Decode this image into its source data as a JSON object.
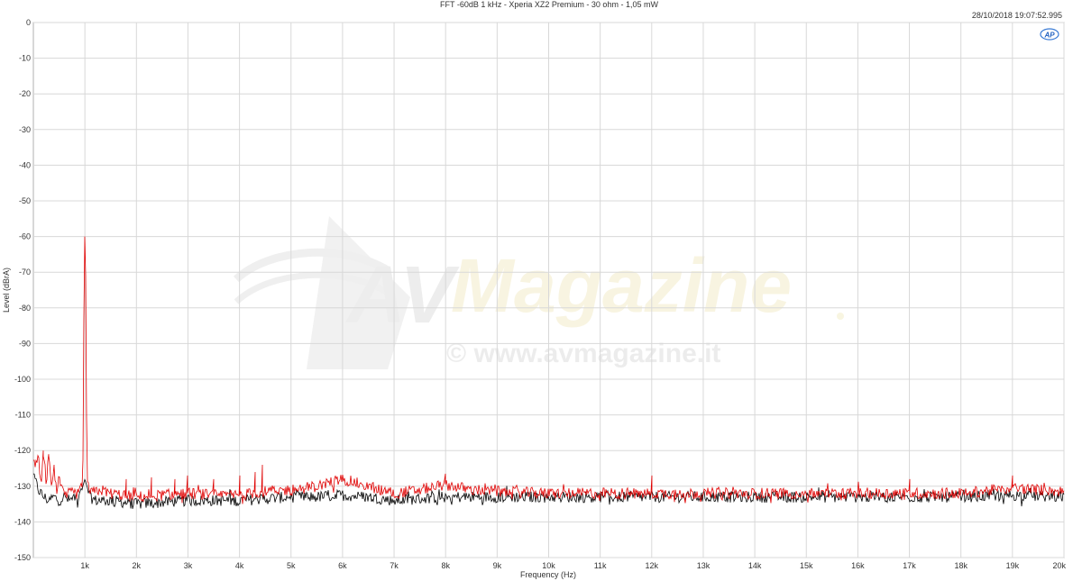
{
  "chart_data": {
    "type": "line",
    "title": "FFT -60dB 1 kHz - Xperia XZ2 Premium - 30 ohm - 1,05 mW",
    "timestamp": "28/10/2018 19:07:52.995",
    "xlabel": "Frequency (Hz)",
    "ylabel": "Level (dBrA)",
    "xlim": [
      0,
      20000
    ],
    "ylim": [
      -150,
      0
    ],
    "grid": true,
    "x_ticks": [
      {
        "value": 1000,
        "label": "1k"
      },
      {
        "value": 2000,
        "label": "2k"
      },
      {
        "value": 3000,
        "label": "3k"
      },
      {
        "value": 4000,
        "label": "4k"
      },
      {
        "value": 5000,
        "label": "5k"
      },
      {
        "value": 6000,
        "label": "6k"
      },
      {
        "value": 7000,
        "label": "7k"
      },
      {
        "value": 8000,
        "label": "8k"
      },
      {
        "value": 9000,
        "label": "9k"
      },
      {
        "value": 10000,
        "label": "10k"
      },
      {
        "value": 11000,
        "label": "11k"
      },
      {
        "value": 12000,
        "label": "12k"
      },
      {
        "value": 13000,
        "label": "13k"
      },
      {
        "value": 14000,
        "label": "14k"
      },
      {
        "value": 15000,
        "label": "15k"
      },
      {
        "value": 16000,
        "label": "16k"
      },
      {
        "value": 17000,
        "label": "17k"
      },
      {
        "value": 18000,
        "label": "18k"
      },
      {
        "value": 19000,
        "label": "19k"
      },
      {
        "value": 20000,
        "label": "20k"
      }
    ],
    "y_ticks": [
      {
        "value": 0,
        "label": "0"
      },
      {
        "value": -10,
        "label": "-10"
      },
      {
        "value": -20,
        "label": "-20"
      },
      {
        "value": -30,
        "label": "-30"
      },
      {
        "value": -40,
        "label": "-40"
      },
      {
        "value": -50,
        "label": "-50"
      },
      {
        "value": -60,
        "label": "-60"
      },
      {
        "value": -70,
        "label": "-70"
      },
      {
        "value": -80,
        "label": "-80"
      },
      {
        "value": -90,
        "label": "-90"
      },
      {
        "value": -100,
        "label": "-100"
      },
      {
        "value": -110,
        "label": "-110"
      },
      {
        "value": -120,
        "label": "-120"
      },
      {
        "value": -130,
        "label": "-130"
      },
      {
        "value": -140,
        "label": "-140"
      },
      {
        "value": -150,
        "label": "-150"
      }
    ],
    "series": [
      {
        "color": "#000000",
        "points": [
          [
            0,
            -127
          ],
          [
            100,
            -131
          ],
          [
            200,
            -133
          ],
          [
            300,
            -134
          ],
          [
            400,
            -133
          ],
          [
            500,
            -134
          ],
          [
            600,
            -133
          ],
          [
            700,
            -134
          ],
          [
            800,
            -133
          ],
          [
            900,
            -133
          ],
          [
            960,
            -130
          ],
          [
            1000,
            -128
          ],
          [
            1040,
            -130
          ],
          [
            1100,
            -133
          ],
          [
            1200,
            -134
          ],
          [
            1500,
            -134
          ],
          [
            2000,
            -135
          ],
          [
            2500,
            -134.5
          ],
          [
            3000,
            -134
          ],
          [
            3500,
            -134
          ],
          [
            4000,
            -134
          ],
          [
            4500,
            -133.5
          ],
          [
            5000,
            -133
          ],
          [
            5500,
            -133
          ],
          [
            6000,
            -132.5
          ],
          [
            6500,
            -133
          ],
          [
            7000,
            -134
          ],
          [
            7500,
            -133.5
          ],
          [
            8000,
            -133
          ],
          [
            8500,
            -133
          ],
          [
            9000,
            -133
          ],
          [
            10000,
            -133
          ],
          [
            11000,
            -133
          ],
          [
            12000,
            -133
          ],
          [
            13000,
            -133
          ],
          [
            14000,
            -133
          ],
          [
            15000,
            -133
          ],
          [
            16000,
            -133
          ],
          [
            17000,
            -133
          ],
          [
            18000,
            -133
          ],
          [
            19000,
            -132.5
          ],
          [
            20000,
            -133
          ]
        ]
      },
      {
        "color": "#e00000",
        "points": [
          [
            0,
            -124
          ],
          [
            100,
            -122
          ],
          [
            150,
            -131
          ],
          [
            200,
            -120
          ],
          [
            250,
            -130
          ],
          [
            300,
            -121
          ],
          [
            350,
            -131
          ],
          [
            400,
            -124
          ],
          [
            450,
            -132
          ],
          [
            500,
            -128
          ],
          [
            550,
            -131
          ],
          [
            600,
            -133
          ],
          [
            700,
            -132
          ],
          [
            800,
            -132
          ],
          [
            900,
            -132
          ],
          [
            960,
            -128
          ],
          [
            990,
            -60
          ],
          [
            1010,
            -60
          ],
          [
            1040,
            -128
          ],
          [
            1100,
            -132
          ],
          [
            1300,
            -131
          ],
          [
            1500,
            -132
          ],
          [
            2000,
            -133
          ],
          [
            2500,
            -132.5
          ],
          [
            3000,
            -132
          ],
          [
            3500,
            -132.5
          ],
          [
            4000,
            -132.5
          ],
          [
            4500,
            -131.5
          ],
          [
            5000,
            -131
          ],
          [
            5500,
            -130
          ],
          [
            6000,
            -128
          ],
          [
            6500,
            -130
          ],
          [
            7000,
            -132
          ],
          [
            7500,
            -131
          ],
          [
            8000,
            -129.5
          ],
          [
            8500,
            -131
          ],
          [
            9000,
            -131.5
          ],
          [
            10000,
            -132
          ],
          [
            11000,
            -132
          ],
          [
            12000,
            -132
          ],
          [
            13000,
            -132
          ],
          [
            14000,
            -132
          ],
          [
            15000,
            -132
          ],
          [
            16000,
            -132
          ],
          [
            17000,
            -132
          ],
          [
            18000,
            -132
          ],
          [
            19000,
            -130.5
          ],
          [
            20000,
            -131.5
          ]
        ],
        "spikes": [
          [
            200,
            -120
          ],
          [
            300,
            -121
          ],
          [
            400,
            -124
          ],
          [
            1800,
            -128
          ],
          [
            2300,
            -127.5
          ],
          [
            2750,
            -128
          ],
          [
            3000,
            -127
          ],
          [
            3500,
            -128
          ],
          [
            4000,
            -127
          ],
          [
            4300,
            -126
          ],
          [
            4450,
            -124
          ],
          [
            8000,
            -126.5
          ],
          [
            12000,
            -127
          ],
          [
            17000,
            -128
          ],
          [
            19000,
            -127
          ]
        ]
      }
    ]
  },
  "watermark": {
    "brand": "AV",
    "name": "Magazine",
    "url": "© www.avmagazine.it"
  },
  "logo": "AP"
}
